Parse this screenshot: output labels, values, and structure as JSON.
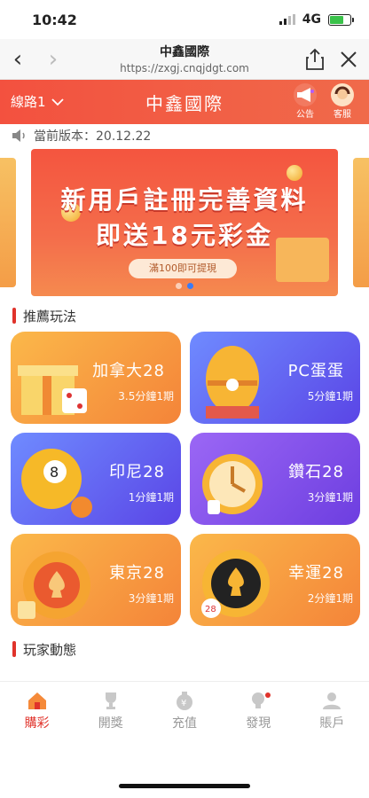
{
  "status": {
    "time": "10:42",
    "network": "4G"
  },
  "browser": {
    "title": "中鑫國際",
    "url": "https://zxgj.cnqjdgt.com"
  },
  "appbar": {
    "line_label": "線路1",
    "title": "中鑫國際",
    "notice_label": "公告",
    "service_label": "客服"
  },
  "notice": {
    "text": "當前版本：20.12.22"
  },
  "banner": {
    "line1": "新用戶註冊完善資料",
    "line2": "即送18元彩金",
    "pill": "滿100即可提現",
    "active_dot": 1
  },
  "recommend": {
    "heading": "推薦玩法"
  },
  "games": [
    {
      "name": "加拿大28",
      "period": "3.5分鐘1期",
      "theme": "orange",
      "art": "gift"
    },
    {
      "name": "PC蛋蛋",
      "period": "5分鐘1期",
      "theme": "blue",
      "art": "egg"
    },
    {
      "name": "印尼28",
      "period": "1分鐘1期",
      "theme": "blue",
      "art": "ball"
    },
    {
      "name": "鑽石28",
      "period": "3分鐘1期",
      "theme": "purple",
      "art": "clock"
    },
    {
      "name": "東京28",
      "period": "3分鐘1期",
      "theme": "orange",
      "art": "chip"
    },
    {
      "name": "幸運28",
      "period": "2分鐘1期",
      "theme": "orange",
      "art": "spade"
    }
  ],
  "players": {
    "heading": "玩家動態"
  },
  "tabs": [
    {
      "label": "購彩",
      "icon": "home-icon",
      "active": true
    },
    {
      "label": "開獎",
      "icon": "trophy-icon",
      "active": false
    },
    {
      "label": "充值",
      "icon": "money-bag-icon",
      "active": false
    },
    {
      "label": "發現",
      "icon": "bulb-icon",
      "active": false
    },
    {
      "label": "賬戶",
      "icon": "user-icon",
      "active": false
    }
  ],
  "colors": {
    "brand_red": "#e0332b",
    "appbar": "#f3513f",
    "blue": "#3a7bf7"
  }
}
